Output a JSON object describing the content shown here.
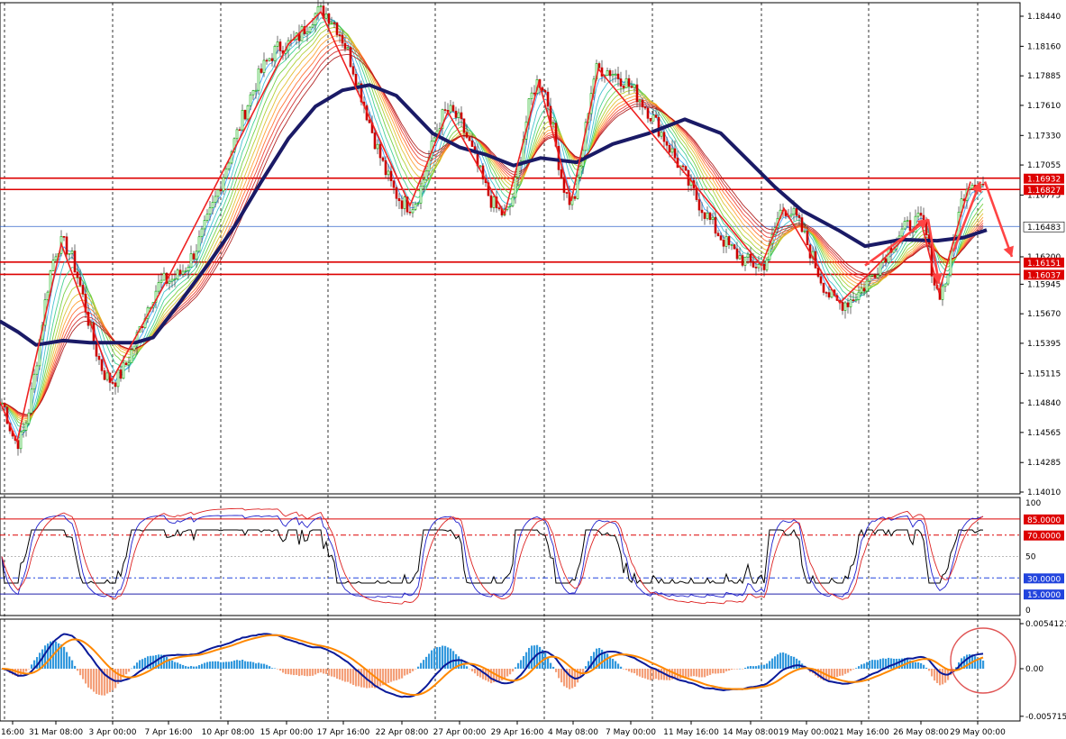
{
  "colors": {
    "background": "#ffffff",
    "grid": "#000000",
    "candle_up": "#00aa00",
    "candle_down": "#cc0000",
    "zigzag": "#ee2222",
    "slow_ma": "#1a1a66",
    "level_red": "#dd0000",
    "level_blue": "#3366cc",
    "rsi_black": "#000000",
    "rsi_blue": "#1f1fcc",
    "rsi_red": "#dd2222",
    "macd_hist_pos": "#3399dd",
    "macd_hist_neg": "#f4a07a",
    "macd_line": "#0a1a99",
    "macd_signal": "#ff8800",
    "circle": "#e05555"
  },
  "price_axis": {
    "ticks": [
      "1.18440",
      "1.18160",
      "1.17885",
      "1.17610",
      "1.17330",
      "1.17055",
      "1.16775",
      "1.16200",
      "1.15945",
      "1.15670",
      "1.15395",
      "1.15115",
      "1.14840",
      "1.14565",
      "1.14285",
      "1.14010"
    ],
    "ylim": [
      1.1401,
      1.1862
    ]
  },
  "price_tags": [
    {
      "text": "1.16932",
      "value": 1.16932,
      "kind": "red"
    },
    {
      "text": "1.16827",
      "value": 1.16827,
      "kind": "red"
    },
    {
      "text": "1.16483",
      "value": 1.16483,
      "kind": "current"
    },
    {
      "text": "1.16151",
      "value": 1.16151,
      "kind": "red"
    },
    {
      "text": "1.16037",
      "value": 1.16037,
      "kind": "red"
    }
  ],
  "rsi_axis": {
    "ticks": [
      "100",
      "50",
      "0"
    ],
    "levels": [
      {
        "text": "85.0000",
        "value": 85,
        "kind": "red"
      },
      {
        "text": "70.0000",
        "value": 70,
        "kind": "red"
      },
      {
        "text": "30.0000",
        "value": 30,
        "kind": "blue"
      },
      {
        "text": "15.0000",
        "value": 15,
        "kind": "blue"
      }
    ]
  },
  "macd_axis": {
    "ticks": [
      "0.0054121",
      "0.00",
      "-0.0057158"
    ]
  },
  "time_axis": {
    "labels": [
      "16:00",
      "31 Mar 08:00",
      "3 Apr 00:00",
      "7 Apr 16:00",
      "10 Apr 08:00",
      "15 Apr 00:00",
      "17 Apr 16:00",
      "22 Apr 08:00",
      "27 Apr 00:00",
      "29 Apr 16:00",
      "4 May 08:00",
      "7 May 00:00",
      "11 May 16:00",
      "14 May 08:00",
      "19 May 00:00",
      "21 May 16:00",
      "26 May 08:00",
      "29 May 00:00"
    ]
  },
  "chart_data": {
    "type": "line",
    "symbol_note": "",
    "zigzag": [
      [
        0,
        1.1485
      ],
      [
        19,
        1.1448
      ],
      [
        68,
        1.1632
      ],
      [
        124,
        1.1505
      ],
      [
        185,
        1.1598
      ],
      [
        320,
        1.1818
      ],
      [
        356,
        1.1848
      ],
      [
        455,
        1.1668
      ],
      [
        497,
        1.1755
      ],
      [
        560,
        1.166
      ],
      [
        598,
        1.1783
      ],
      [
        634,
        1.1672
      ],
      [
        664,
        1.1795
      ],
      [
        845,
        1.1612
      ],
      [
        870,
        1.1665
      ],
      [
        932,
        1.1577
      ],
      [
        1022,
        1.1653
      ],
      [
        1042,
        1.1587
      ],
      [
        1077,
        1.169
      ]
    ],
    "slow_ma": [
      [
        0,
        1.156
      ],
      [
        20,
        1.155
      ],
      [
        40,
        1.1538
      ],
      [
        70,
        1.1542
      ],
      [
        100,
        1.154
      ],
      [
        150,
        1.154
      ],
      [
        170,
        1.1545
      ],
      [
        200,
        1.1578
      ],
      [
        230,
        1.1612
      ],
      [
        260,
        1.1648
      ],
      [
        290,
        1.169
      ],
      [
        320,
        1.173
      ],
      [
        350,
        1.176
      ],
      [
        380,
        1.1775
      ],
      [
        410,
        1.178
      ],
      [
        440,
        1.177
      ],
      [
        480,
        1.1735
      ],
      [
        510,
        1.1722
      ],
      [
        540,
        1.1715
      ],
      [
        570,
        1.1705
      ],
      [
        600,
        1.1712
      ],
      [
        640,
        1.1708
      ],
      [
        680,
        1.1725
      ],
      [
        720,
        1.1735
      ],
      [
        760,
        1.1748
      ],
      [
        800,
        1.1735
      ],
      [
        830,
        1.171
      ],
      [
        860,
        1.1685
      ],
      [
        890,
        1.1663
      ],
      [
        930,
        1.1645
      ],
      [
        960,
        1.163
      ],
      [
        1000,
        1.1636
      ],
      [
        1040,
        1.1635
      ],
      [
        1070,
        1.1638
      ],
      [
        1095,
        1.1645
      ]
    ],
    "current_price": 1.16483,
    "arrows": [
      {
        "from": [
          960,
          1.1612
        ],
        "to": [
          1030,
          1.1655
        ]
      },
      {
        "from": [
          1030,
          1.1655
        ],
        "to": [
          1042,
          1.1595
        ]
      },
      {
        "from": [
          1058,
          1.1625
        ],
        "to": [
          1088,
          1.169
        ]
      },
      {
        "from": [
          1093,
          1.169
        ],
        "to": [
          1123,
          1.162
        ]
      }
    ],
    "rsi_note": "stochastic-like oscillator with levels 85/70/30/15",
    "macd_note": "histogram with main and signal lines"
  }
}
